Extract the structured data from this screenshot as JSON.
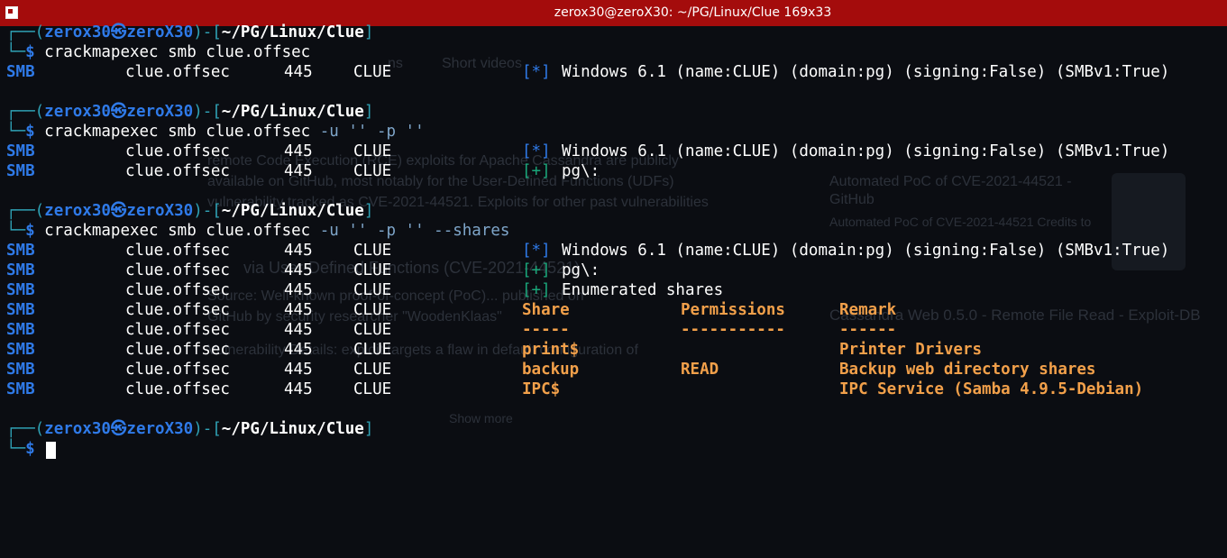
{
  "window": {
    "title": "zerox30@zeroX30: ~/PG/Linux/Clue 169x33"
  },
  "background_page": {
    "lines": [
      "remote Code Execution (RCE) exploits for Apache Cassandra are publicly",
      "available on GitHub, most notably for the User-Defined Functions (UDFs)",
      "vulnerability tracked as CVE-2021-44521. Exploits for other past vulnerabilities",
      "Automated PoC of CVE-2021-44521 -",
      "GitHub",
      "Automated PoC of CVE-2021-44521 Credits to",
      "via User-Defined Functions (CVE-2021-44521)",
      "Source: Well-known proof-of-concept (PoC)... published on",
      "GitHub by security researcher \"WoodenKlaas\"",
      "Cassandra Web 0.5.0 - Remote File Read - Exploit-DB",
      "Vulnerability Details: exploit targets a flaw in default configuration of",
      "Show more",
      "ns",
      "Short videos"
    ]
  },
  "prompt": {
    "user": "zerox30",
    "separator": "㉿",
    "host": "zeroX30",
    "path": "~/PG/Linux/Clue"
  },
  "blocks": [
    {
      "command": {
        "tool": "crackmapexec",
        "args": "smb clue.offsec",
        "opts": ""
      },
      "output": [
        {
          "proto": "SMB",
          "host": "clue.offsec",
          "port": "445",
          "name": "CLUE",
          "mark": "[*]",
          "msg": "Windows 6.1 (name:CLUE) (domain:pg) (signing:False) (SMBv1:True)"
        }
      ]
    },
    {
      "command": {
        "tool": "crackmapexec",
        "args": "smb clue.offsec",
        "opts": "-u '' -p ''"
      },
      "output": [
        {
          "proto": "SMB",
          "host": "clue.offsec",
          "port": "445",
          "name": "CLUE",
          "mark": "[*]",
          "msg": "Windows 6.1 (name:CLUE) (domain:pg) (signing:False) (SMBv1:True)"
        },
        {
          "proto": "SMB",
          "host": "clue.offsec",
          "port": "445",
          "name": "CLUE",
          "mark": "[+]",
          "msg": "pg\\:"
        }
      ]
    },
    {
      "command": {
        "tool": "crackmapexec",
        "args": "smb clue.offsec",
        "opts": "-u '' -p '' --shares"
      },
      "output": [
        {
          "proto": "SMB",
          "host": "clue.offsec",
          "port": "445",
          "name": "CLUE",
          "mark": "[*]",
          "msg": "Windows 6.1 (name:CLUE) (domain:pg) (signing:False) (SMBv1:True)"
        },
        {
          "proto": "SMB",
          "host": "clue.offsec",
          "port": "445",
          "name": "CLUE",
          "mark": "[+]",
          "msg": "pg\\:"
        },
        {
          "proto": "SMB",
          "host": "clue.offsec",
          "port": "445",
          "name": "CLUE",
          "mark": "[+]",
          "msg": "Enumerated shares"
        }
      ],
      "shares_table": {
        "headers": [
          "Share",
          "Permissions",
          "Remark"
        ],
        "underline": [
          "-----",
          "-----------",
          "------"
        ],
        "rows": [
          {
            "share": "print$",
            "perm": "",
            "remark": "Printer Drivers"
          },
          {
            "share": "backup",
            "perm": "READ",
            "remark": "Backup web directory shares"
          },
          {
            "share": "IPC$",
            "perm": "",
            "remark": "IPC Service (Samba 4.9.5-Debian)"
          }
        ],
        "row_meta": {
          "proto": "SMB",
          "host": "clue.offsec",
          "port": "445",
          "name": "CLUE"
        }
      }
    }
  ],
  "final_prompt_symbol": "$",
  "colors": {
    "titlebar": "#a40c0c",
    "background": "#0b0d12",
    "prompt_frame": "#2fa2b5",
    "user_blue": "#2f7ae8",
    "status_green": "#1aa67a",
    "share_orange": "#f2a04a"
  }
}
